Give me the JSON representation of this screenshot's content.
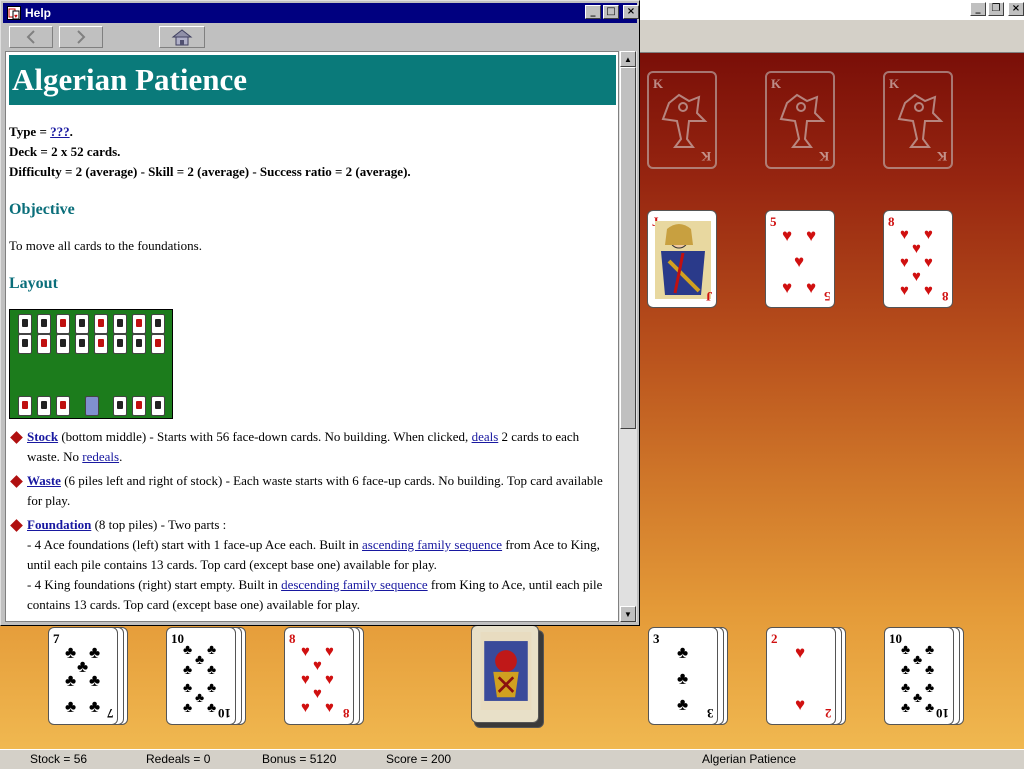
{
  "game": {
    "window_controls": [
      "_",
      "❐",
      "×"
    ],
    "status": {
      "stock": "Stock = 56",
      "redeals": "Redeals = 0",
      "bonus": "Bonus = 5120",
      "score": "Score = 200",
      "game_name": "Algerian Patience"
    },
    "foundation_kings": [
      "K",
      "K",
      "K"
    ],
    "middle_cards": [
      {
        "rank": "J",
        "suit": "heart",
        "face": true
      },
      {
        "rank": "5",
        "suit": "heart"
      },
      {
        "rank": "8",
        "suit": "heart"
      }
    ],
    "waste_cards": [
      {
        "rank": "7",
        "suit": "club"
      },
      {
        "rank": "10",
        "suit": "club"
      },
      {
        "rank": "8",
        "suit": "heart"
      },
      {
        "rank": "3",
        "suit": "club"
      },
      {
        "rank": "2",
        "suit": "heart"
      },
      {
        "rank": "10",
        "suit": "club"
      }
    ]
  },
  "help": {
    "title": "Help",
    "controls": [
      "_",
      "□",
      "×"
    ],
    "nav": {
      "back": "back-arrow-icon",
      "forward": "forward-arrow-icon",
      "home": "home-icon"
    },
    "heading": "Algerian Patience",
    "type_label": "Type = ",
    "type_link": "???",
    "type_end": ".",
    "deck": "Deck = 2 x 52 cards.",
    "difficulty": "Difficulty = 2 (average) - Skill = 2 (average) - Success ratio = 2 (average).",
    "objective_heading": "Objective",
    "objective_text": "To move all cards to the foundations.",
    "layout_heading": "Layout",
    "stock": {
      "label": "Stock",
      "t1": " (bottom middle) - Starts with 56 face-down cards. No building. When clicked, ",
      "link1": "deals",
      "t2": " 2 cards to each waste. No ",
      "link2": "redeals",
      "t3": "."
    },
    "waste": {
      "label": "Waste",
      "t1": " (6 piles left and right of stock) - Each waste starts with 6 face-up cards. No building. Top card available for play."
    },
    "foundation": {
      "label": "Foundation",
      "t1": " (8 top piles) - Two parts :",
      "l1a": "- 4 Ace foundations (left) start with 1 face-up Ace each. Built in ",
      "l1link": "ascending family sequence",
      "l1b": " from Ace to King, until each pile contains 13 cards. Top card (except base one) available for play.",
      "l2a": "- 4 King foundations (right) start empty. Built in ",
      "l2link": "descending family sequence",
      "l2b": " from King to Ace, until each pile contains 13 cards. Top card (except base one) available for play."
    }
  }
}
